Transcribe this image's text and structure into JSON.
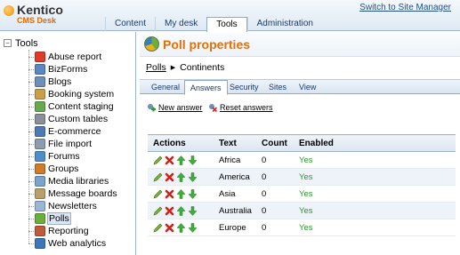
{
  "header": {
    "brand": "Kentico",
    "subtitle": "CMS Desk",
    "switch_link": "Switch to Site Manager",
    "tabs": [
      {
        "label": "Content"
      },
      {
        "label": "My desk"
      },
      {
        "label": "Tools",
        "active": true
      },
      {
        "label": "Administration"
      }
    ]
  },
  "tree": {
    "root": {
      "label": "Tools",
      "toggle": "−"
    },
    "items": [
      {
        "label": "Abuse report",
        "icon": "abuse-report-icon",
        "color": "#e23b2b"
      },
      {
        "label": "BizForms",
        "icon": "bizforms-icon",
        "color": "#5b86c4"
      },
      {
        "label": "Blogs",
        "icon": "blogs-icon",
        "color": "#6f8fb8"
      },
      {
        "label": "Booking system",
        "icon": "booking-system-icon",
        "color": "#c9a04a"
      },
      {
        "label": "Content staging",
        "icon": "content-staging-icon",
        "color": "#6aa84f"
      },
      {
        "label": "Custom tables",
        "icon": "custom-tables-icon",
        "color": "#8a8f99"
      },
      {
        "label": "E-commerce",
        "icon": "ecommerce-icon",
        "color": "#4f79b5"
      },
      {
        "label": "File import",
        "icon": "file-import-icon",
        "color": "#8c9db2"
      },
      {
        "label": "Forums",
        "icon": "forums-icon",
        "color": "#4f8fc9"
      },
      {
        "label": "Groups",
        "icon": "groups-icon",
        "color": "#d07a2b"
      },
      {
        "label": "Media libraries",
        "icon": "media-libraries-icon",
        "color": "#7aa3cf"
      },
      {
        "label": "Message boards",
        "icon": "message-boards-icon",
        "color": "#b8a06a"
      },
      {
        "label": "Newsletters",
        "icon": "newsletters-icon",
        "color": "#9ab5d6"
      },
      {
        "label": "Polls",
        "icon": "polls-icon",
        "color": "#6cae3b",
        "selected": true
      },
      {
        "label": "Reporting",
        "icon": "reporting-icon",
        "color": "#c05a3a"
      },
      {
        "label": "Web analytics",
        "icon": "web-analytics-icon",
        "color": "#3d77b8"
      }
    ]
  },
  "main": {
    "title": "Poll properties",
    "breadcrumb": {
      "link": "Polls",
      "separator": "▶",
      "current": "Continents"
    },
    "subtabs": [
      {
        "label": "General"
      },
      {
        "label": "Answers",
        "active": true
      },
      {
        "label": "Security"
      },
      {
        "label": "Sites"
      },
      {
        "label": "View"
      }
    ],
    "actions": {
      "new_answer": "New answer",
      "reset_answers": "Reset answers"
    },
    "table": {
      "headers": [
        "Actions",
        "Text",
        "Count",
        "Enabled"
      ],
      "rows": [
        {
          "text": "Africa",
          "count": "0",
          "enabled": "Yes"
        },
        {
          "text": "America",
          "count": "0",
          "enabled": "Yes"
        },
        {
          "text": "Asia",
          "count": "0",
          "enabled": "Yes"
        },
        {
          "text": "Australia",
          "count": "0",
          "enabled": "Yes"
        },
        {
          "text": "Europe",
          "count": "0",
          "enabled": "Yes"
        }
      ]
    }
  },
  "colors": {
    "accent_orange": "#e0700a",
    "enabled_green": "#2a9a2a",
    "link_blue": "#1e4e8c"
  }
}
